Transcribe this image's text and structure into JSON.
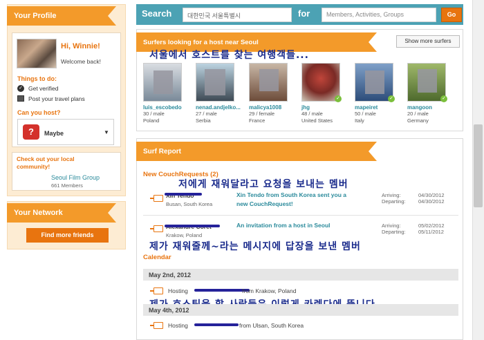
{
  "profile": {
    "title": "Your Profile",
    "greeting": "Hi, Winnie!",
    "welcome": "Welcome back!",
    "things_title": "Things to do:",
    "todo_verified": "Get verified",
    "todo_travel": "Post your travel plans",
    "can_host_title": "Can you host?",
    "host_status": "Maybe",
    "community_title": "Check out your local community!",
    "group_name": "Seoul Film Group",
    "group_members": "661 Members"
  },
  "network": {
    "title": "Your Network",
    "button": "Find more friends"
  },
  "search": {
    "label": "Search",
    "location_value": "대한민국 서울특별시",
    "for_label": "for",
    "query_placeholder": "Members, Activities, Groups",
    "go_button": "Go"
  },
  "surfers_section": {
    "title": "Surfers looking for a host near Seoul",
    "show_more": "Show more surfers",
    "annotation": "서울에서 호스트를 찾는 여행객들...",
    "surfers": [
      {
        "name": "luis_escobedo",
        "age_sex": "30 / male",
        "country": "Poland"
      },
      {
        "name": "nenad.andjelko...",
        "age_sex": "27 / male",
        "country": "Serbia"
      },
      {
        "name": "malicya1008",
        "age_sex": "29 / female",
        "country": "France"
      },
      {
        "name": "jhg",
        "age_sex": "48 / male",
        "country": "United States"
      },
      {
        "name": "mapeiret",
        "age_sex": "50 / male",
        "country": "Italy"
      },
      {
        "name": "mangoon",
        "age_sex": "20 / male",
        "country": "Germany"
      }
    ]
  },
  "surf_report": {
    "title": "Surf Report",
    "new_requests_title": "New CouchRequests (2)",
    "annotation_1": "저에게 재워달라고 요청을 보내는 멤버",
    "annotation_2": "제가 재워줄께~라는 메시지에 답장을 보낸 멤버",
    "annotation_3": "제가 호스팅을 할 사람들은 이렇게 카렌다에 뜹니다",
    "requests": [
      {
        "name": "Xin Tendo",
        "location": "Busan, South Korea",
        "message_line1": "Xin Tendo from South Korea sent you a",
        "message_line2": "new CouchRequest!",
        "arriving_label": "Arriving:",
        "arriving": "04/30/2012",
        "departing_label": "Departing:",
        "departing": "04/30/2012"
      },
      {
        "name": "Alexandre Coret",
        "location": "Krakow, Poland",
        "message_line1": "An invitation from a host in Seoul",
        "message_line2": "",
        "arriving_label": "Arriving:",
        "arriving": "05/02/2012",
        "departing_label": "Departing:",
        "departing": "05/11/2012"
      }
    ],
    "calendar_title": "Calendar",
    "calendar": [
      {
        "date": "May 2nd, 2012",
        "hosting_label": "Hosting",
        "from": "from Krakow, Poland"
      },
      {
        "date": "May 4th, 2012",
        "hosting_label": "Hosting",
        "from": "from Ulsan, South Korea"
      }
    ]
  },
  "colors": {
    "accent_orange": "#f39a2a",
    "search_teal": "#4ca2b4",
    "link_teal": "#2a8a9b",
    "annotation_blue": "#1a2b8c",
    "panel_peach": "#fdecd3"
  }
}
